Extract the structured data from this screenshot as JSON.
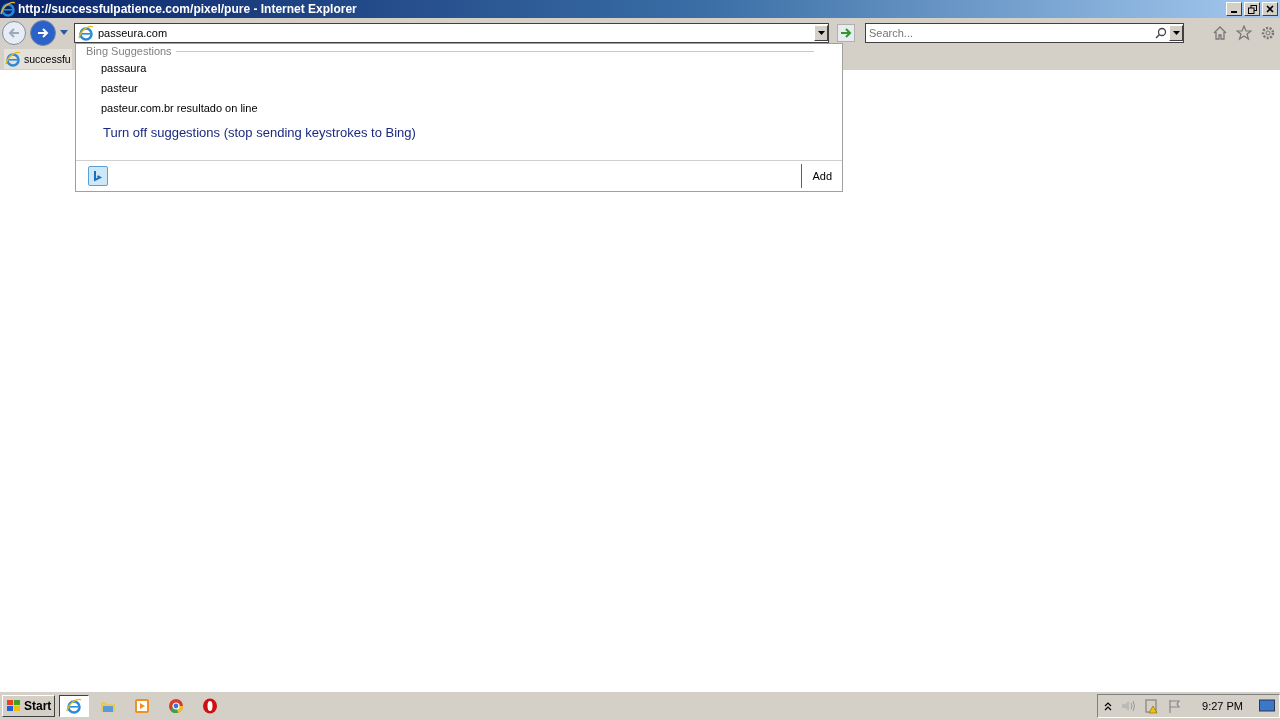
{
  "window": {
    "title": "http://successfulpatience.com/pixel/pure - Internet Explorer"
  },
  "address": {
    "value": "passeura.com"
  },
  "search": {
    "placeholder": "Search..."
  },
  "tab": {
    "label": "successfu"
  },
  "suggestions": {
    "header": "Bing Suggestions",
    "items": [
      "passaura",
      "pasteur",
      "pasteur.com.br resultado on line"
    ],
    "turn_off": "Turn off suggestions (stop sending keystrokes to Bing)",
    "add": "Add"
  },
  "taskbar": {
    "start": "Start",
    "apps": [
      {
        "kind": "ie",
        "selected": true
      },
      {
        "kind": "folder",
        "selected": false
      },
      {
        "kind": "media",
        "selected": false
      },
      {
        "kind": "chrome",
        "selected": false
      },
      {
        "kind": "opera",
        "selected": false
      }
    ],
    "clock": "9:27 PM"
  }
}
